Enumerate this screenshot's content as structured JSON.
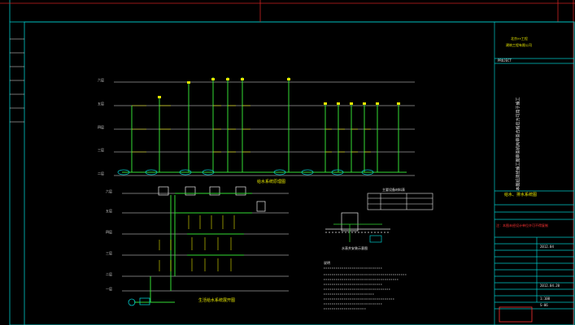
{
  "drawing": {
    "company_line1": "北京××工程",
    "company_line2": "建筑工程有限公司",
    "project_label": "PROJECT",
    "drawing_title": "给水、排水系统图",
    "plan1_title": "给水系统原理图",
    "plan2_title": "生活给水系统展开图",
    "vertical_note": "本图纸须经施工图审查机构审查合格后方可用于施工",
    "legend_title": "主要设备材料表",
    "detail_title": "水表井安装示意图",
    "notes_title": "说明",
    "date1": "2012.04",
    "date2": "2012.04.20",
    "scale": "1:100",
    "sheet_no": "S-06",
    "warning_text": "注：本图未经设计单位许可不得复制",
    "level_labels": [
      "六层",
      "五层",
      "四层",
      "三层",
      "二层"
    ],
    "lower_level_labels": [
      "六层",
      "五层",
      "四层",
      "三层",
      "二层",
      "一层"
    ]
  },
  "colors": {
    "frame": "#00c8c8",
    "pipe_green": "#33dd33",
    "yellow": "#e6e600",
    "red": "#ff3333",
    "white": "#e8e8e8",
    "magenta": "#dd44dd"
  }
}
